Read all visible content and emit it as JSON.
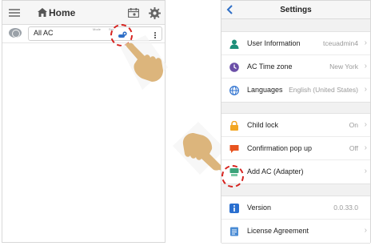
{
  "left": {
    "header": {
      "title": "Home"
    },
    "ac_item": {
      "name": "All AC",
      "mode_label": "Mode",
      "set_label": "Set"
    }
  },
  "right": {
    "header": {
      "title": "Settings"
    },
    "groups": [
      [
        {
          "label": "User Information",
          "value": "tceuadmin4"
        },
        {
          "label": "AC Time zone",
          "value": "New York"
        },
        {
          "label": "Languages",
          "value": "English (United States)"
        }
      ],
      [
        {
          "label": "Child lock",
          "value": "On"
        },
        {
          "label": "Confirmation pop up",
          "value": "Off"
        },
        {
          "label": "Add AC (Adapter)",
          "value": ""
        }
      ],
      [
        {
          "label": "Version",
          "value": "0.0.33.0"
        },
        {
          "label": "License Agreement",
          "value": ""
        }
      ]
    ]
  },
  "colors": {
    "accent_blue": "#2f6fc7",
    "highlight_red": "#d6231f",
    "hand_skin": "#dcb57c"
  }
}
